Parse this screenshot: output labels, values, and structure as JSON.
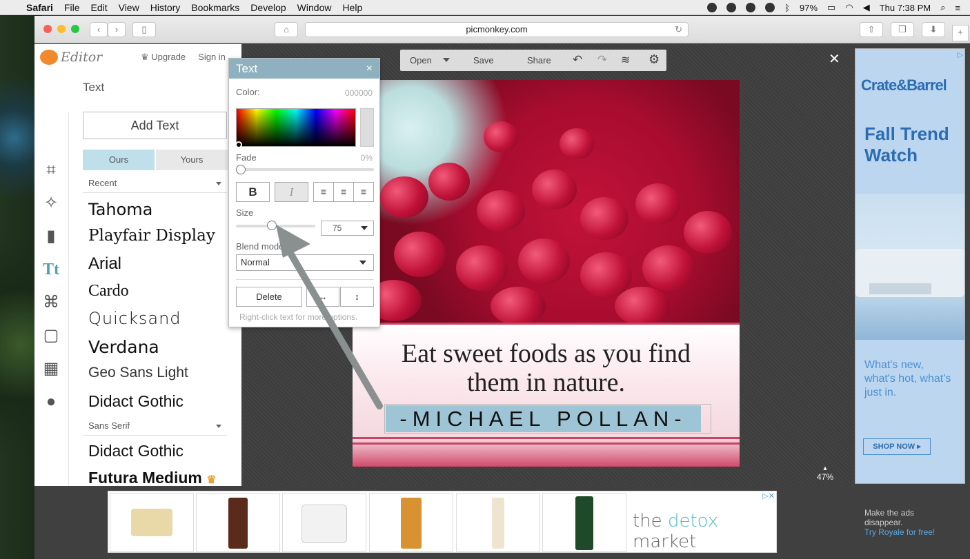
{
  "menubar": {
    "app_name": "Safari",
    "items": [
      "File",
      "Edit",
      "View",
      "History",
      "Bookmarks",
      "Develop",
      "Window",
      "Help"
    ],
    "battery": "97%",
    "clock": "Thu 7:38 PM"
  },
  "browser": {
    "url": "picmonkey.com"
  },
  "editor": {
    "logo_text": "Editor",
    "upgrade": "Upgrade",
    "signin": "Sign in",
    "panel_title": "Text",
    "add_text": "Add Text",
    "tab_ours": "Ours",
    "tab_yours": "Yours",
    "recent": "Recent",
    "fonts_recent": [
      "Tahoma",
      "Playfair Display",
      "Arial",
      "Cardo",
      "Quicksand",
      "Verdana",
      "Geo Sans Light",
      "Didact Gothic"
    ],
    "category": "Sans Serif",
    "fonts_sans": [
      "Didact Gothic",
      "Futura Medium"
    ],
    "toolbar": {
      "open": "Open",
      "save": "Save",
      "share": "Share"
    },
    "close_symbol": "✕",
    "zoom": "47%"
  },
  "text_dialog": {
    "title": "Text",
    "close": "×",
    "color_label": "Color:",
    "color_value": "000000",
    "fade_label": "Fade",
    "fade_value": "0%",
    "bold": "B",
    "italic": "I",
    "size_label": "Size",
    "size_value": "75",
    "size_level": 0.45,
    "blend_label": "Blend mode",
    "blend_value": "Normal",
    "delete": "Delete",
    "hint": "Right-click text for more options."
  },
  "canvas": {
    "quote_line1": "Eat sweet foods as you find",
    "quote_line2": "them in nature.",
    "author": "-MICHAEL POLLAN-"
  },
  "ads": {
    "side_brand": "Crate&Barrel",
    "side_headline": "Fall Trend Watch",
    "side_sub": "What's new, what's hot, what's just in.",
    "side_cta": "SHOP NOW ▸",
    "bottom_brand_the": "the ",
    "bottom_brand_detox": "detox",
    "bottom_brand_market": " market",
    "footer_line1": "Make the ads",
    "footer_line2": "disappear.",
    "footer_link": "Try Royale for free!"
  }
}
